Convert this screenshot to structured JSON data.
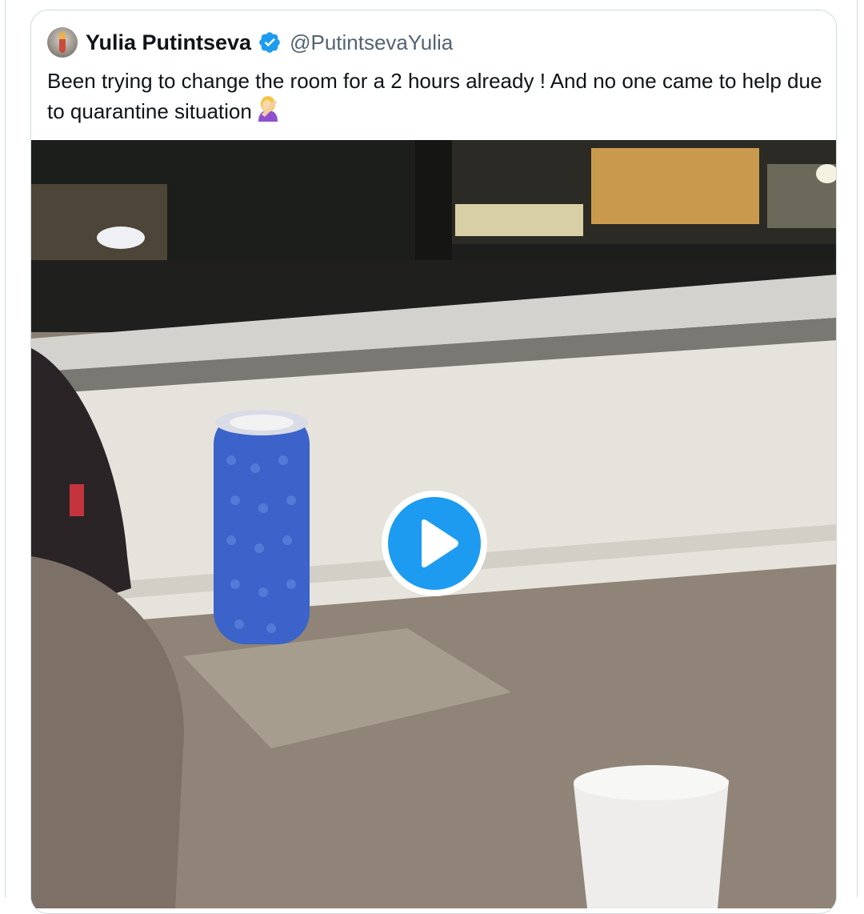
{
  "tweet": {
    "author_name": "Yulia Putintseva",
    "handle": "@PutintsevaYulia",
    "text": "Been trying to change the room for a 2 hours already ! And no one came to help due to quarantine situation",
    "emoji": "facepalm-emoji"
  },
  "media": {
    "type": "video",
    "control": "play-icon"
  },
  "colors": {
    "accent": "#1d9bf0",
    "text": "#0f1419",
    "secondary": "#536471",
    "border": "#cfd9de"
  }
}
